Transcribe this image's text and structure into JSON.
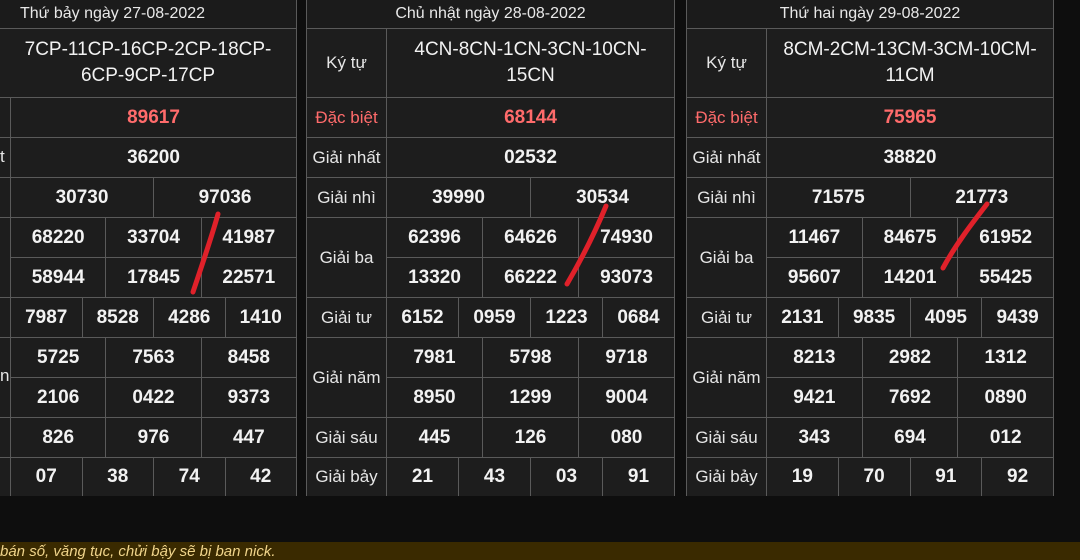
{
  "panels": [
    {
      "header": "Thứ bảy ngày 27-08-2022",
      "kytu_label": "",
      "kytu_value": "7CP-11CP-16CP-2CP-18CP-6CP-9CP-17CP",
      "dacbiet_label": "",
      "dacbiet": "89617",
      "nhat_label": "t",
      "nhat": "36200",
      "nhi_label": "",
      "nhi": [
        "30730",
        "97036"
      ],
      "ba_label": "",
      "ba": [
        [
          "68220",
          "33704",
          "41987"
        ],
        [
          "58944",
          "17845",
          "22571"
        ]
      ],
      "tu_label": "",
      "tu": [
        "7987",
        "8528",
        "4286",
        "1410"
      ],
      "nam_label": "n",
      "nam": [
        [
          "5725",
          "7563",
          "8458"
        ],
        [
          "2106",
          "0422",
          "9373"
        ]
      ],
      "sau_label": "",
      "sau": [
        "826",
        "976",
        "447"
      ],
      "bay_label": "",
      "bay": [
        "07",
        "38",
        "74",
        "42"
      ]
    },
    {
      "header": "Chủ nhật ngày 28-08-2022",
      "kytu_label": "Ký tự",
      "kytu_value": "4CN-8CN-1CN-3CN-10CN-15CN",
      "dacbiet_label": "Đặc biệt",
      "dacbiet": "68144",
      "nhat_label": "Giải nhất",
      "nhat": "02532",
      "nhi_label": "Giải nhì",
      "nhi": [
        "39990",
        "30534"
      ],
      "ba_label": "Giải ba",
      "ba": [
        [
          "62396",
          "64626",
          "74930"
        ],
        [
          "13320",
          "66222",
          "93073"
        ]
      ],
      "tu_label": "Giải tư",
      "tu": [
        "6152",
        "0959",
        "1223",
        "0684"
      ],
      "nam_label": "Giải năm",
      "nam": [
        [
          "7981",
          "5798",
          "9718"
        ],
        [
          "8950",
          "1299",
          "9004"
        ]
      ],
      "sau_label": "Giải sáu",
      "sau": [
        "445",
        "126",
        "080"
      ],
      "bay_label": "Giải bảy",
      "bay": [
        "21",
        "43",
        "03",
        "91"
      ]
    },
    {
      "header": "Thứ hai ngày 29-08-2022",
      "kytu_label": "Ký tự",
      "kytu_value": "8CM-2CM-13CM-3CM-10CM-11CM",
      "dacbiet_label": "Đặc biệt",
      "dacbiet": "75965",
      "nhat_label": "Giải nhất",
      "nhat": "38820",
      "nhi_label": "Giải nhì",
      "nhi": [
        "71575",
        "21773"
      ],
      "ba_label": "Giải ba",
      "ba": [
        [
          "11467",
          "84675",
          "61952"
        ],
        [
          "95607",
          "14201",
          "55425"
        ]
      ],
      "tu_label": "Giải tư",
      "tu": [
        "2131",
        "9835",
        "4095",
        "9439"
      ],
      "nam_label": "Giải năm",
      "nam": [
        [
          "8213",
          "2982",
          "1312"
        ],
        [
          "9421",
          "7692",
          "0890"
        ]
      ],
      "sau_label": "Giải sáu",
      "sau": [
        "343",
        "694",
        "012"
      ],
      "bay_label": "Giải bảy",
      "bay": [
        "19",
        "70",
        "91",
        "92"
      ]
    }
  ],
  "footer": {
    "text": "bán số, văng tục, chửi bậy sẽ bị ban nick."
  },
  "colors": {
    "special": "#ff6b6b",
    "annotation": "#e0212a"
  }
}
